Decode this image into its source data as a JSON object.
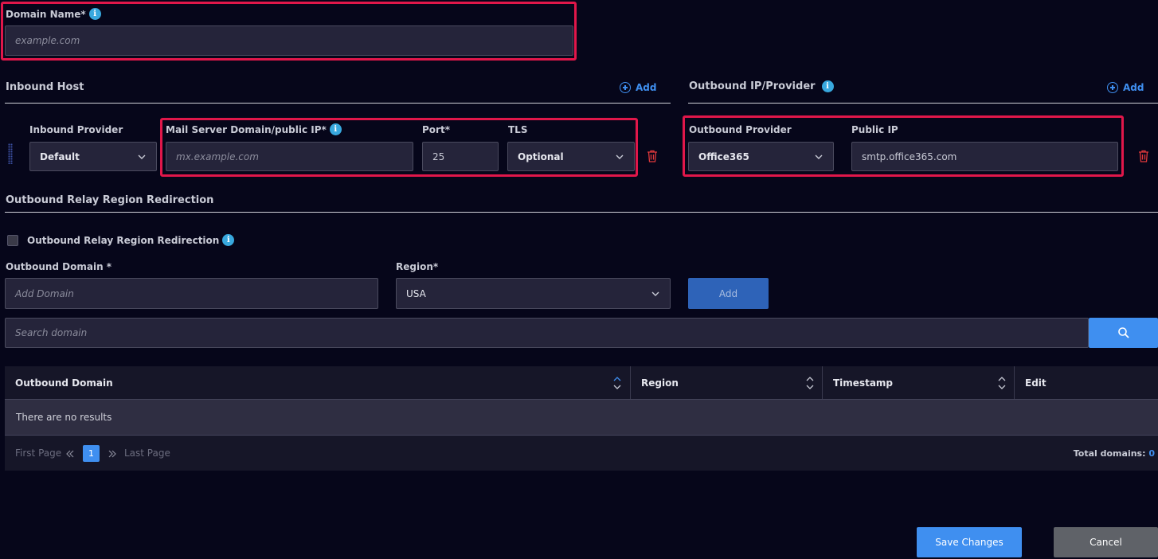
{
  "domain_name": {
    "label": "Domain Name*",
    "placeholder": "example.com"
  },
  "inbound": {
    "title": "Inbound Host",
    "add_label": "Add",
    "provider_label": "Inbound Provider",
    "provider_value": "Default",
    "mail_server_label": "Mail Server Domain/public IP*",
    "mail_server_placeholder": "mx.example.com",
    "port_label": "Port*",
    "port_value": "25",
    "tls_label": "TLS",
    "tls_value": "Optional"
  },
  "outbound": {
    "title": "Outbound IP/Provider",
    "add_label": "Add",
    "provider_label": "Outbound Provider",
    "provider_value": "Office365",
    "public_ip_label": "Public IP",
    "public_ip_value": "smtp.office365.com"
  },
  "relay": {
    "title": "Outbound Relay Region Redirection",
    "checkbox_label": "Outbound Relay Region Redirection",
    "domain_label": "Outbound Domain *",
    "domain_placeholder": "Add Domain",
    "region_label": "Region*",
    "region_value": "USA",
    "add_button": "Add",
    "search_placeholder": "Search domain"
  },
  "table": {
    "columns": [
      "Outbound Domain",
      "Region",
      "Timestamp",
      "Edit"
    ],
    "empty_text": "There are no results"
  },
  "pagination": {
    "first": "First Page",
    "current": "1",
    "last": "Last Page",
    "total_label": "Total domains:",
    "total_value": "0"
  },
  "actions": {
    "save": "Save Changes",
    "cancel": "Cancel"
  },
  "colors": {
    "background": "#06061a",
    "accent": "#3f8ff0",
    "highlight": "#e0174a",
    "delete": "#e0383b"
  }
}
